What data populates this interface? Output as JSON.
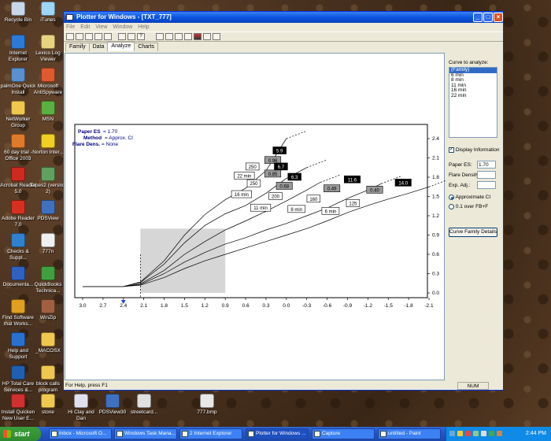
{
  "desktop_icons": [
    {
      "label": "Recycle Bin",
      "color": "#c8d8e8"
    },
    {
      "label": "iTunes",
      "color": "#9ed6f4"
    },
    {
      "label": "Internet Explorer",
      "color": "#2c7ad8"
    },
    {
      "label": "Lexico Log Viewer",
      "color": "#e8d480"
    },
    {
      "label": "palmOne Quick Install",
      "color": "#5a8fd0"
    },
    {
      "label": "Microsoft AntiSpyware",
      "color": "#e05a30"
    },
    {
      "label": "NetWorker Group",
      "color": "#f0c850"
    },
    {
      "label": "MSN",
      "color": "#5ab040"
    },
    {
      "label": "60 day trial - Office 2003",
      "color": "#e07a2a"
    },
    {
      "label": "Norton Inter...",
      "color": "#f0d020"
    },
    {
      "label": "Acrobat Reader 5.0",
      "color": "#d02a20"
    },
    {
      "label": "Tapes2 (version 2)",
      "color": "#60a060"
    },
    {
      "label": "Adobe Reader 7.0",
      "color": "#d83020"
    },
    {
      "label": "PDSView",
      "color": "#4070c0"
    },
    {
      "label": "Checks & Suppl...",
      "color": "#3080d0"
    },
    {
      "label": "777n",
      "color": "#f0f0f0"
    },
    {
      "label": "Documenta...",
      "color": "#3060c0"
    },
    {
      "label": "QuickBooks Technica...",
      "color": "#40a040"
    },
    {
      "label": "Find Software that Works...",
      "color": "#e0a020"
    },
    {
      "label": "WinZip",
      "color": "#a06040"
    },
    {
      "label": "Help and Support",
      "color": "#2a70d0"
    },
    {
      "label": "_MACOSX",
      "color": "#f0c850"
    },
    {
      "label": "HP Total Care Services &...",
      "color": "#2060b0"
    },
    {
      "label": "block calls program",
      "color": "#f0c850"
    },
    {
      "label": "Install Quicken New User E...",
      "color": "#d03030"
    },
    {
      "label": "stone",
      "color": "#f0c850"
    },
    {
      "label": "Hi Clay and Dan",
      "color": "#e0e0f0"
    },
    {
      "label": "PDSView30",
      "color": "#4070c0"
    },
    {
      "label": "streetcard...",
      "color": "#e0e0e0"
    },
    {
      "label": "777.bmp",
      "color": "#e8e8e8"
    }
  ],
  "window": {
    "title": "Plotter for Windows - [TXT_777]",
    "menu": [
      "File",
      "Edit",
      "View",
      "Window",
      "Help"
    ],
    "tabs": [
      "Family",
      "Data",
      "Analyze",
      "Charts"
    ],
    "active_tab": "Analyze",
    "status_text": "For Help, press F1",
    "status_num": "NUM"
  },
  "info_box": {
    "paper_es_label": "Paper ES",
    "paper_es_value": "= 1.70",
    "method_label": "Method",
    "method_value": "= Approx. CI",
    "flare_label": "Flare Dens.",
    "flare_value": "= None"
  },
  "right_panel": {
    "curve_label": "Curve to analyze:",
    "curves": [
      "(Family)",
      "6 min",
      "8 min",
      "11 min",
      "16 min",
      "22 min"
    ],
    "selected_curve": "(Family)",
    "display_info_label": "Display Information",
    "display_info_checked": true,
    "paper_es_label": "Paper ES:",
    "paper_es_value": "1.70",
    "flare_density_label": "Flare Density:",
    "flare_density_value": "",
    "exp_adj_label": "Exp. Adj.:",
    "exp_adj_value": "",
    "radio_approx": "Approximate CI",
    "radio_fb": "0.1 over FB+F",
    "button_label": "Curve Family Details"
  },
  "chart_data": {
    "type": "line",
    "x_ticks": [
      "3.0",
      "2.7",
      "2.4",
      "2.1",
      "1.8",
      "1.5",
      "1.2",
      "0.9",
      "0.6",
      "0.3",
      "0.0",
      "-0.3",
      "-0.6",
      "-0.9",
      "-1.2",
      "-1.5",
      "-1.8",
      "-2.1"
    ],
    "y_ticks": [
      "2.4",
      "2.1",
      "1.8",
      "1.5",
      "1.2",
      "0.9",
      "0.6",
      "0.3",
      "0.0"
    ],
    "xlim": [
      3.0,
      -2.1
    ],
    "ylim": [
      0.0,
      2.4
    ],
    "marker_x": 2.4,
    "dashed_x": 2.15,
    "shaded_region": {
      "x0": 2.15,
      "x1": 0.9,
      "y_max": 1.0
    },
    "series": [
      {
        "name": "22 min",
        "points": [
          [
            3.0,
            0.1
          ],
          [
            2.4,
            0.1
          ],
          [
            2.15,
            0.17
          ],
          [
            1.8,
            0.5
          ],
          [
            1.5,
            0.9
          ],
          [
            1.2,
            1.22
          ],
          [
            0.9,
            1.45
          ],
          [
            0.6,
            1.63
          ],
          [
            0.3,
            1.9
          ],
          [
            0.0,
            2.4
          ]
        ]
      },
      {
        "name": "16 min",
        "points": [
          [
            3.0,
            0.1
          ],
          [
            2.4,
            0.1
          ],
          [
            2.15,
            0.16
          ],
          [
            1.8,
            0.45
          ],
          [
            1.5,
            0.78
          ],
          [
            1.2,
            1.05
          ],
          [
            0.9,
            1.23
          ],
          [
            0.6,
            1.36
          ],
          [
            0.3,
            1.55
          ],
          [
            0.0,
            1.78
          ],
          [
            -0.3,
            1.95
          ]
        ]
      },
      {
        "name": "11 min",
        "points": [
          [
            3.0,
            0.1
          ],
          [
            2.4,
            0.1
          ],
          [
            2.15,
            0.14
          ],
          [
            1.8,
            0.35
          ],
          [
            1.5,
            0.6
          ],
          [
            1.2,
            0.8
          ],
          [
            0.9,
            0.98
          ],
          [
            0.6,
            1.12
          ],
          [
            0.3,
            1.27
          ],
          [
            0.0,
            1.43
          ],
          [
            -0.3,
            1.6
          ],
          [
            -0.5,
            1.72
          ]
        ]
      },
      {
        "name": "8 min",
        "points": [
          [
            3.0,
            0.1
          ],
          [
            2.4,
            0.1
          ],
          [
            2.15,
            0.13
          ],
          [
            1.8,
            0.3
          ],
          [
            1.5,
            0.48
          ],
          [
            1.2,
            0.63
          ],
          [
            0.9,
            0.76
          ],
          [
            0.6,
            0.86
          ],
          [
            0.3,
            0.98
          ],
          [
            0.0,
            1.08
          ],
          [
            -0.3,
            1.2
          ],
          [
            -0.6,
            1.32
          ],
          [
            -0.9,
            1.47
          ],
          [
            -1.2,
            1.6
          ],
          [
            -1.4,
            1.7
          ]
        ]
      },
      {
        "name": "6 min",
        "points": [
          [
            3.0,
            0.1
          ],
          [
            2.4,
            0.1
          ],
          [
            2.15,
            0.12
          ],
          [
            1.8,
            0.24
          ],
          [
            1.5,
            0.38
          ],
          [
            1.2,
            0.5
          ],
          [
            0.9,
            0.6
          ],
          [
            0.6,
            0.7
          ],
          [
            0.3,
            0.8
          ],
          [
            0.0,
            0.9
          ],
          [
            -0.3,
            1.0
          ],
          [
            -0.6,
            1.12
          ],
          [
            -0.9,
            1.25
          ],
          [
            -1.2,
            1.36
          ],
          [
            -1.5,
            1.46
          ],
          [
            -1.8,
            1.55
          ],
          [
            -2.1,
            1.65
          ]
        ]
      }
    ],
    "curve_labels": [
      {
        "text": "22 min",
        "x": 0.62,
        "y": 1.82
      },
      {
        "text": "16 min",
        "x": 0.66,
        "y": 1.53
      },
      {
        "text": "11 min",
        "x": 0.38,
        "y": 1.32
      },
      {
        "text": "8 min",
        "x": -0.15,
        "y": 1.3
      },
      {
        "text": "6 min",
        "x": -0.65,
        "y": 1.27
      }
    ],
    "value_labels": [
      {
        "text": "5.9",
        "x": 0.1,
        "y": 2.21,
        "style": "black"
      },
      {
        "text": "0.96",
        "x": 0.2,
        "y": 2.06,
        "style": "gray"
      },
      {
        "text": "250",
        "x": 0.5,
        "y": 1.96,
        "style": "white"
      },
      {
        "text": "6.7",
        "x": 0.08,
        "y": 1.96,
        "style": "black"
      },
      {
        "text": "0.85",
        "x": 0.2,
        "y": 1.85,
        "style": "gray"
      },
      {
        "text": "250",
        "x": 0.48,
        "y": 1.7,
        "style": "white"
      },
      {
        "text": "6.3",
        "x": -0.12,
        "y": 1.8,
        "style": "black"
      },
      {
        "text": "0.68",
        "x": 0.03,
        "y": 1.66,
        "style": "gray"
      },
      {
        "text": "200",
        "x": 0.16,
        "y": 1.5,
        "style": "white"
      },
      {
        "text": "11.6",
        "x": -0.97,
        "y": 1.76,
        "style": "black"
      },
      {
        "text": "0.49",
        "x": -0.67,
        "y": 1.62,
        "style": "gray"
      },
      {
        "text": "160",
        "x": -0.4,
        "y": 1.46,
        "style": "white"
      },
      {
        "text": "14.0",
        "x": -1.72,
        "y": 1.71,
        "style": "black"
      },
      {
        "text": "0.40",
        "x": -1.3,
        "y": 1.6,
        "style": "gray"
      },
      {
        "text": "125",
        "x": -0.98,
        "y": 1.39,
        "style": "white"
      }
    ]
  },
  "taskbar": {
    "start_label": "start",
    "tasks": [
      "Inbox - Microsoft O...",
      "Windows Task Mana...",
      "2 Internet Explorer",
      "Plotter for Windows ...",
      "Capture",
      "untitled - Paint"
    ],
    "active_task": "Plotter for Windows ...",
    "clock": "2:44 PM"
  }
}
